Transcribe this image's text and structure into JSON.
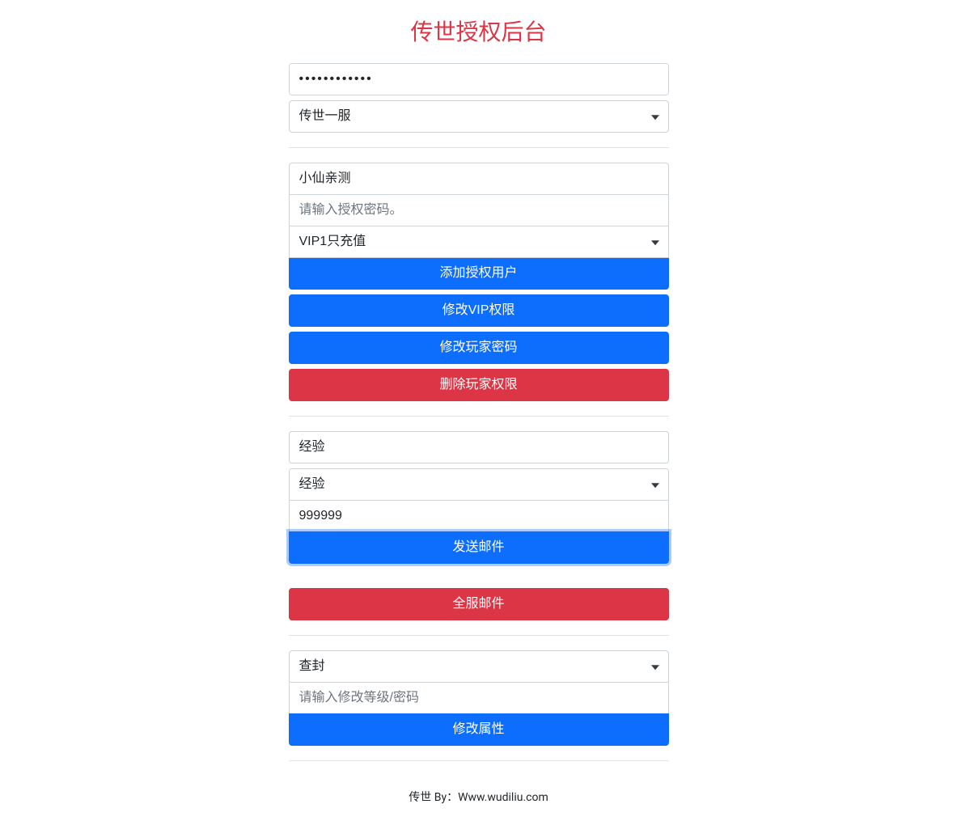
{
  "header": {
    "title": "传世授权后台"
  },
  "section1": {
    "password_value": "************",
    "server_select": "传世一服"
  },
  "section2": {
    "username_value": "小仙亲测",
    "auth_password_placeholder": "请输入授权密码。",
    "vip_select": "VIP1只充值",
    "buttons": {
      "add_auth_user": "添加授权用户",
      "modify_vip": "修改VIP权限",
      "modify_password": "修改玩家密码",
      "delete_permission": "删除玩家权限"
    }
  },
  "section3": {
    "item_input_value": "经验",
    "item_select": "经验",
    "amount_value": "999999",
    "send_mail": "发送邮件"
  },
  "section4": {
    "full_server_mail": "全服邮件"
  },
  "section5": {
    "ban_select": "查封",
    "modify_level_placeholder": "请输入修改等级/密码",
    "modify_attr": "修改属性"
  },
  "footer": {
    "text": "传世 By：Www.wudiliu.com"
  }
}
